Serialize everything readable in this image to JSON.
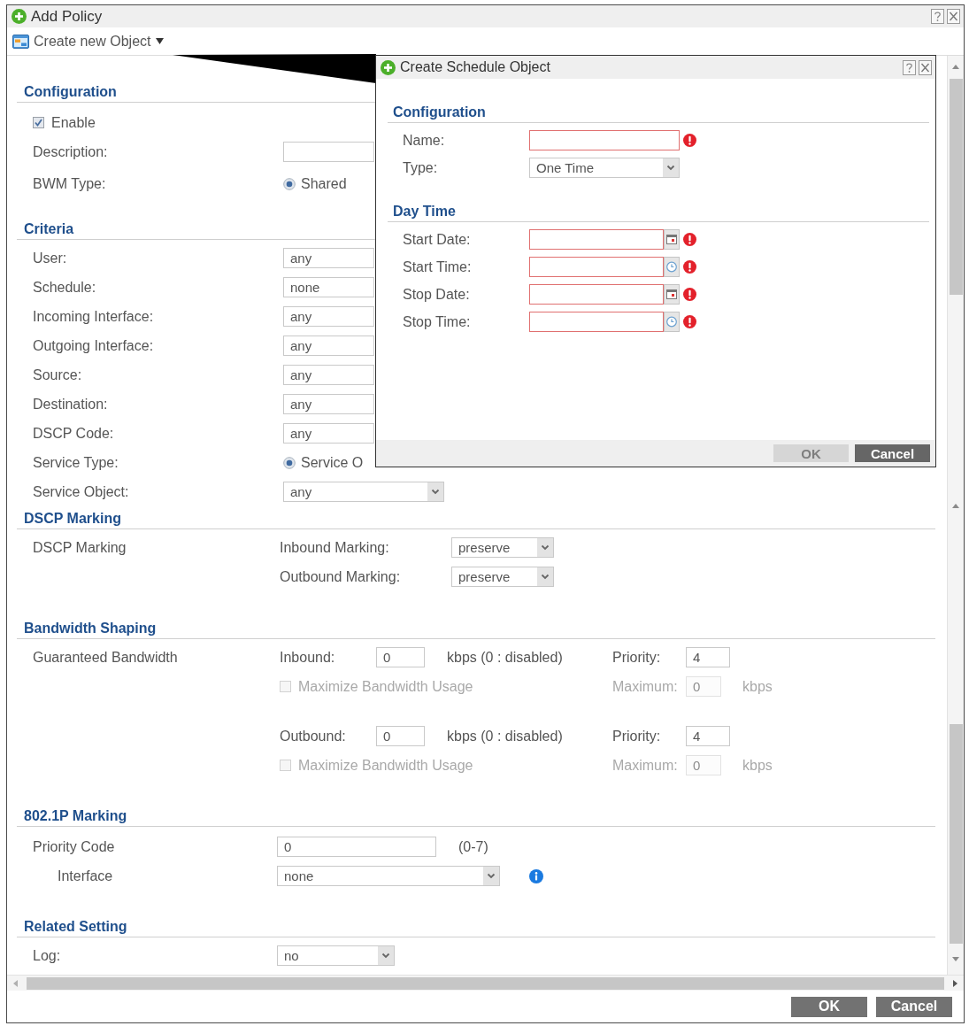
{
  "window": {
    "title": "Add Policy"
  },
  "toolbar": {
    "label": "Create new Object"
  },
  "configuration": {
    "heading": "Configuration",
    "enable": {
      "label": "Enable",
      "checked": true
    },
    "description": {
      "label": "Description:"
    },
    "bwm_type": {
      "label": "BWM Type:",
      "option": {
        "label": "Shared",
        "selected": true
      }
    }
  },
  "criteria": {
    "heading": "Criteria",
    "rows": [
      {
        "kind": "box",
        "label": "User:",
        "value": "any"
      },
      {
        "kind": "box",
        "label": "Schedule:",
        "value": "none"
      },
      {
        "kind": "box",
        "label": "Incoming Interface:",
        "value": "any"
      },
      {
        "kind": "box",
        "label": "Outgoing Interface:",
        "value": "any"
      },
      {
        "kind": "box",
        "label": "Source:",
        "value": "any"
      },
      {
        "kind": "box",
        "label": "Destination:",
        "value": "any"
      },
      {
        "kind": "box",
        "label": "DSCP Code:",
        "value": "any"
      },
      {
        "kind": "radio",
        "label": "Service Type:",
        "option": {
          "label": "Service O",
          "selected": true
        }
      },
      {
        "kind": "select",
        "label": "Service Object:",
        "value": "any"
      }
    ]
  },
  "dscp_marking": {
    "heading": "DSCP Marking",
    "label": "DSCP Marking",
    "rows": [
      {
        "label": "Inbound Marking:",
        "value": "preserve"
      },
      {
        "label": "Outbound Marking:",
        "value": "preserve"
      }
    ]
  },
  "bandwidth_shaping": {
    "heading": "Bandwidth Shaping",
    "label": "Guaranteed Bandwidth",
    "directions": [
      {
        "label": "Inbound:",
        "value": "0",
        "note": "kbps (0 : disabled)",
        "priority_label": "Priority:",
        "priority": "4",
        "maximize": {
          "label": "Maximize Bandwidth Usage",
          "checked": false,
          "disabled": true
        },
        "maximum": {
          "label": "Maximum:",
          "value": "0",
          "unit": "kbps",
          "disabled": true
        }
      },
      {
        "label": "Outbound:",
        "value": "0",
        "note": "kbps (0 : disabled)",
        "priority_label": "Priority:",
        "priority": "4",
        "maximize": {
          "label": "Maximize Bandwidth Usage",
          "checked": false,
          "disabled": true
        },
        "maximum": {
          "label": "Maximum:",
          "value": "0",
          "unit": "kbps",
          "disabled": true
        }
      }
    ]
  },
  "p8021_marking": {
    "heading": "802.1P Marking",
    "priority_code": {
      "label": "Priority Code",
      "value": "0",
      "hint": "(0-7)"
    },
    "interface": {
      "label": "Interface",
      "value": "none"
    }
  },
  "related_setting": {
    "heading": "Related Setting",
    "log": {
      "label": "Log:",
      "value": "no"
    }
  },
  "footer": {
    "buttons": [
      {
        "label": "OK"
      },
      {
        "label": "Cancel"
      }
    ]
  },
  "dialog": {
    "title": "Create Schedule Object",
    "sections": [
      {
        "heading": "Configuration",
        "fields": [
          {
            "kind": "text",
            "label": "Name:",
            "required": true
          },
          {
            "kind": "select",
            "label": "Type:",
            "value": "One Time",
            "required": false
          }
        ]
      },
      {
        "heading": "Day Time",
        "fields": [
          {
            "kind": "date",
            "label": "Start Date:",
            "required": true
          },
          {
            "kind": "time",
            "label": "Start Time:",
            "required": true
          },
          {
            "kind": "date",
            "label": "Stop Date:",
            "required": true
          },
          {
            "kind": "time",
            "label": "Stop Time:",
            "required": true
          }
        ]
      }
    ],
    "buttons": [
      {
        "label": "OK",
        "disabled": true
      },
      {
        "label": "Cancel",
        "disabled": false
      }
    ]
  }
}
